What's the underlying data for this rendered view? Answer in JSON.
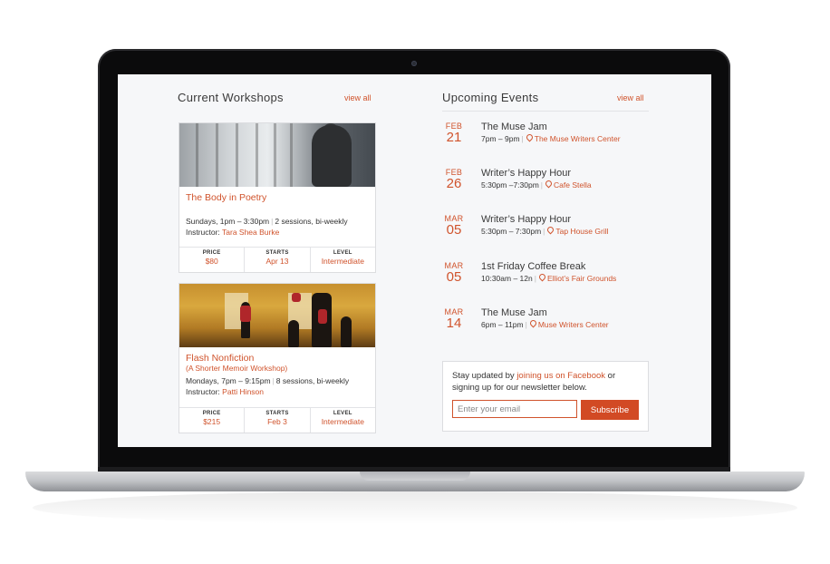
{
  "workshops": {
    "title": "Current Workshops",
    "view_all": "view all",
    "items": [
      {
        "title": "The Body in Poetry",
        "subtitle": "",
        "schedule": "Sundays, 1pm – 3:30pm",
        "sessions": "2 sessions, bi-weekly",
        "instructor_label": "Instructor:",
        "instructor": "Tara Shea Burke",
        "price_label": "PRICE",
        "price": "$80",
        "starts_label": "STARTS",
        "starts": "Apr 13",
        "level_label": "LEVEL",
        "level": "Intermediate"
      },
      {
        "title": "Flash Nonfiction",
        "subtitle": "(A Shorter Memoir Workshop)",
        "schedule": "Mondays, 7pm – 9:15pm",
        "sessions": "8 sessions, bi-weekly",
        "instructor_label": "Instructor:",
        "instructor": "Patti Hinson",
        "price_label": "PRICE",
        "price": "$215",
        "starts_label": "STARTS",
        "starts": "Feb 3",
        "level_label": "LEVEL",
        "level": "Intermediate"
      }
    ]
  },
  "events": {
    "title": "Upcoming Events",
    "view_all": "view all",
    "items": [
      {
        "month": "FEB",
        "day": "21",
        "name": "The Muse Jam",
        "time": "7pm – 9pm",
        "location": "The Muse Writers Center"
      },
      {
        "month": "FEB",
        "day": "26",
        "name": "Writer’s Happy Hour",
        "time": "5:30pm –7:30pm",
        "location": "Cafe Stella"
      },
      {
        "month": "MAR",
        "day": "05",
        "name": "Writer’s Happy Hour",
        "time": "5:30pm – 7:30pm",
        "location": "Tap House Grill"
      },
      {
        "month": "MAR",
        "day": "05",
        "name": "1st Friday Coffee Break",
        "time": "10:30am – 12n",
        "location": "Elliot’s Fair Grounds"
      },
      {
        "month": "MAR",
        "day": "14",
        "name": "The Muse Jam",
        "time": "6pm – 11pm",
        "location": "Muse Writers Center"
      }
    ]
  },
  "newsletter": {
    "text_before": "Stay updated by ",
    "link": "joining us on Facebook",
    "text_after": " or signing up for our newsletter below.",
    "placeholder": "Enter your email",
    "button": "Subscribe"
  },
  "colors": {
    "accent": "#d0532c",
    "screen_bg": "#f6f7f9"
  }
}
